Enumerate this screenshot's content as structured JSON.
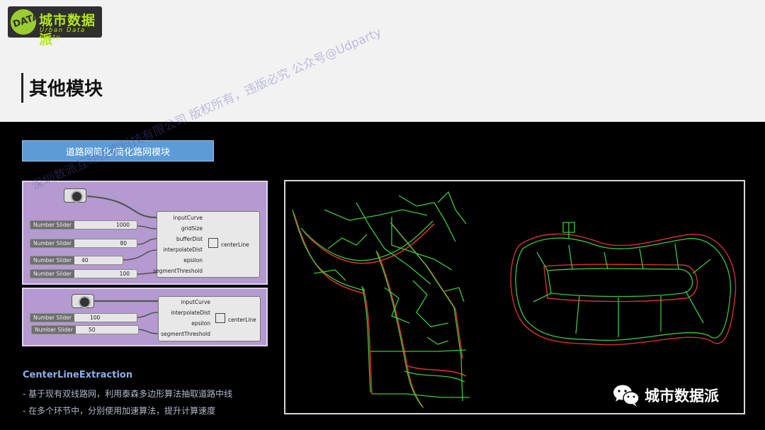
{
  "brand": {
    "name": "城市数据派",
    "subtitle": "Urban Data Party",
    "badge": "DATA"
  },
  "page": {
    "title": "其他模块"
  },
  "module": {
    "tab_label": "道路网简化/简化路网模块"
  },
  "grasshopper": {
    "panel_a": {
      "sliders": [
        {
          "label": "Number Slider",
          "value": "1000"
        },
        {
          "label": "Number Slider",
          "value": "80"
        },
        {
          "label": "Number Slider",
          "value": "40"
        },
        {
          "label": "Number Slider",
          "value": "100"
        }
      ],
      "inputs": [
        "inputCurve",
        "gridSize",
        "bufferDist",
        "interpolateDist",
        "epsilon",
        "segmentThreshold"
      ],
      "output": "centerLine"
    },
    "panel_b": {
      "sliders": [
        {
          "label": "Number Slider",
          "value": "100"
        },
        {
          "label": "Number Slider",
          "value": "50"
        }
      ],
      "inputs": [
        "inputCurve",
        "interpolateDist",
        "epsilon",
        "segmentThreshold"
      ],
      "output": "centerLine"
    },
    "watermark": "深圳数派互动传媒科技有限公司 版权所有，违版必究 公众号@Udparty"
  },
  "description": {
    "heading": "CenterLineExtraction",
    "bullets": [
      "- 基于现有双线路网，利用泰森多边形算法抽取道路中线",
      "- 在多个环节中，分别使用加速算法，提升计算速度"
    ]
  },
  "wechat": {
    "account": "城市数据派"
  },
  "colors": {
    "accent": "#5c9bd6",
    "road_center": "#3ec73e",
    "road_edge": "#d23232",
    "brand_green": "#b5e61d"
  }
}
